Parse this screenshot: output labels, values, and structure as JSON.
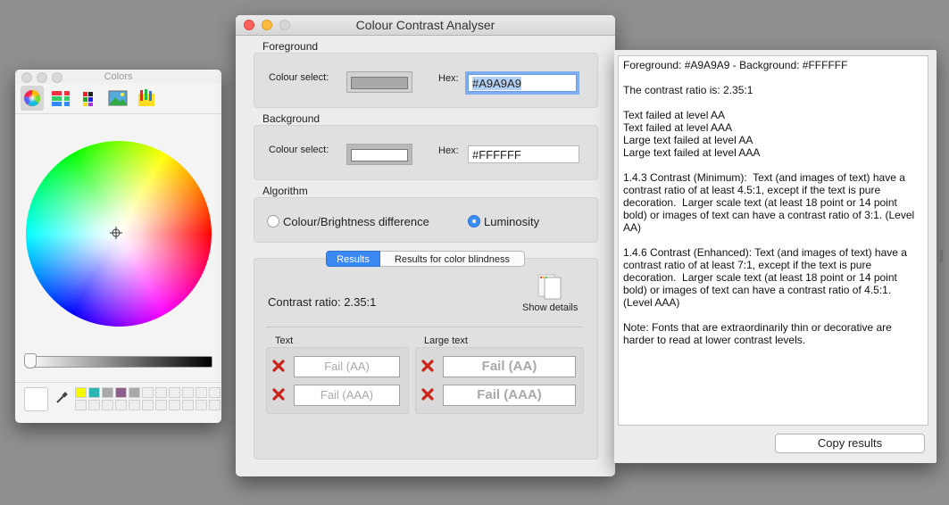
{
  "colors_panel": {
    "title": "Colors",
    "tabs": [
      "color-wheel",
      "color-sliders",
      "color-palettes",
      "image-palettes",
      "crayons"
    ],
    "selected_tab": "color-wheel",
    "current_color": "#FFFFFF",
    "swatches": [
      "#F6F600",
      "#2BB5B5",
      "#A8A8A8",
      "#8A5F8A",
      "#A9A9A9"
    ]
  },
  "main_window": {
    "title": "Colour Contrast Analyser",
    "foreground": {
      "section_label": "Foreground",
      "colour_select_label": "Colour select:",
      "hex_label": "Hex:",
      "hex_value": "#A9A9A9",
      "swatch_color": "#A9A9A9"
    },
    "background": {
      "section_label": "Background",
      "colour_select_label": "Colour select:",
      "hex_label": "Hex:",
      "hex_value": "#FFFFFF",
      "swatch_color": "#FFFFFF"
    },
    "algorithm": {
      "section_label": "Algorithm",
      "option_brightness": "Colour/Brightness difference",
      "option_luminosity": "Luminosity",
      "selected": "Luminosity"
    },
    "results": {
      "tab_results": "Results",
      "tab_blindness": "Results for color blindness",
      "contrast_ratio": "Contrast ratio: 2.35:1",
      "show_details": "Show details",
      "text_heading": "Text",
      "large_text_heading": "Large text",
      "text_aa": "Fail (AA)",
      "text_aaa": "Fail (AAA)",
      "large_aa": "Fail (AA)",
      "large_aaa": "Fail (AAA)"
    }
  },
  "results_window": {
    "text": "Foreground: #A9A9A9 - Background: #FFFFFF\n\nThe contrast ratio is: 2.35:1\n\nText failed at level AA\nText failed at level AAA\nLarge text failed at level AA\nLarge text failed at level AAA\n\n1.4.3 Contrast (Minimum):  Text (and images of text) have a contrast ratio of at least 4.5:1, except if the text is pure decoration.  Larger scale text (at least 18 point or 14 point bold) or images of text can have a contrast ratio of 3:1. (Level AA)\n\n1.4.6 Contrast (Enhanced): Text (and images of text) have a contrast ratio of at least 7:1, except if the text is pure decoration.  Larger scale text (at least 18 point or 14 point bold) or images of text can have a contrast ratio of 4.5:1. (Level AAA)\n\nNote: Fonts that are extraordinarily thin or decorative are harder to read at lower contrast levels.",
    "copy_button": "Copy results"
  }
}
